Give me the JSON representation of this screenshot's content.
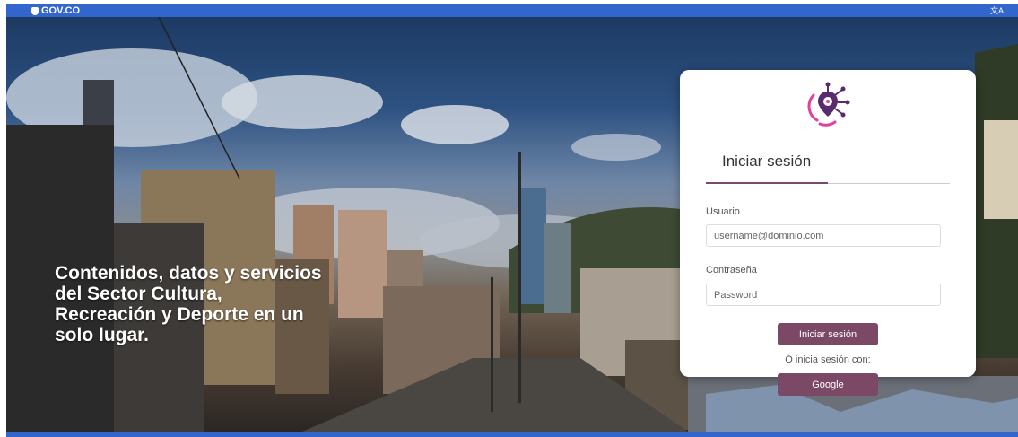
{
  "gov_bar": {
    "logo_text": "GOV.CO",
    "translate_icon": "translate-icon"
  },
  "hero": {
    "tagline": "Contenidos, datos y servicios del Sector Cultura, Recreación y Deporte en un solo lugar."
  },
  "login": {
    "logo_icon": "location-network-icon",
    "tab_title": "Iniciar sesión",
    "username_label": "Usuario",
    "username_placeholder": "username@dominio.com",
    "password_label": "Contraseña",
    "password_placeholder": "Password",
    "submit_label": "Iniciar sesión",
    "alt_text": "Ó inicia sesión con:",
    "google_label": "Google"
  },
  "colors": {
    "gov_blue": "#3366cc",
    "accent": "#7b4966",
    "logo_pink": "#e040a0",
    "logo_purple": "#5a2a6e"
  }
}
